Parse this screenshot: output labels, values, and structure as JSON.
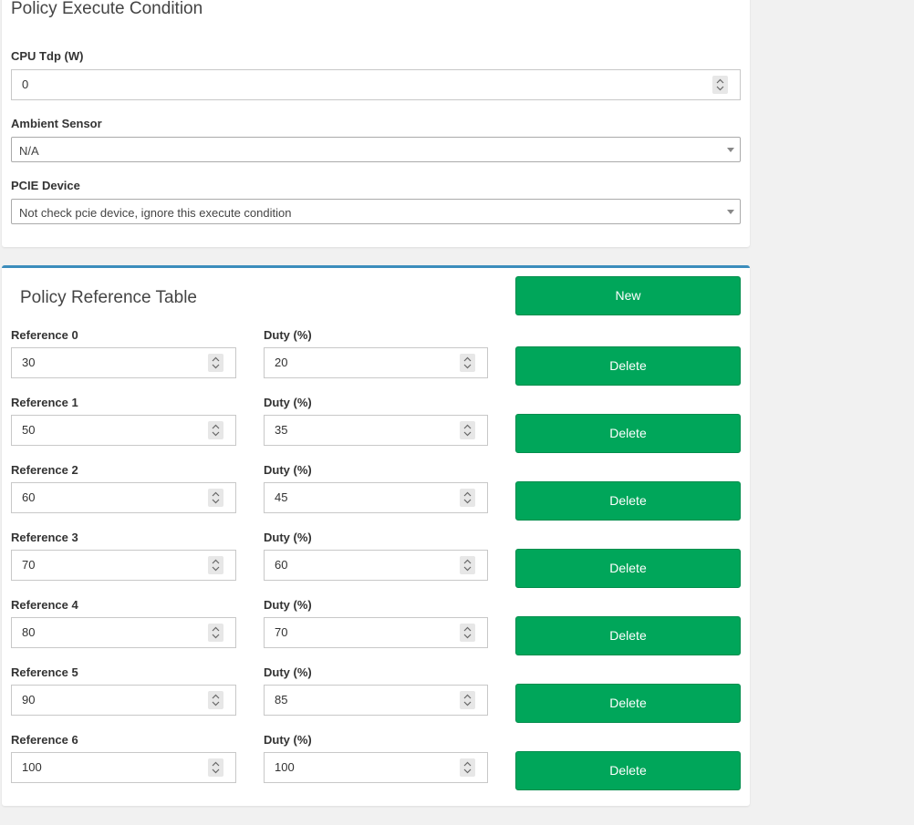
{
  "exec": {
    "title": "Policy Execute Condition",
    "cpu_tdp": {
      "label": "CPU Tdp (W)",
      "value": "0"
    },
    "ambient_sensor": {
      "label": "Ambient Sensor",
      "value": "N/A"
    },
    "pcie_device": {
      "label": "PCIE Device",
      "value": "Not check pcie device, ignore this execute condition"
    }
  },
  "ref": {
    "title": "Policy Reference Table",
    "new_label": "New",
    "rows": [
      {
        "ref_label": "Reference 0",
        "ref_value": "30",
        "duty_label": "Duty (%)",
        "duty_value": "20",
        "delete_label": "Delete"
      },
      {
        "ref_label": "Reference 1",
        "ref_value": "50",
        "duty_label": "Duty (%)",
        "duty_value": "35",
        "delete_label": "Delete"
      },
      {
        "ref_label": "Reference 2",
        "ref_value": "60",
        "duty_label": "Duty (%)",
        "duty_value": "45",
        "delete_label": "Delete"
      },
      {
        "ref_label": "Reference 3",
        "ref_value": "70",
        "duty_label": "Duty (%)",
        "duty_value": "60",
        "delete_label": "Delete"
      },
      {
        "ref_label": "Reference 4",
        "ref_value": "80",
        "duty_label": "Duty (%)",
        "duty_value": "70",
        "delete_label": "Delete"
      },
      {
        "ref_label": "Reference 5",
        "ref_value": "90",
        "duty_label": "Duty (%)",
        "duty_value": "85",
        "delete_label": "Delete"
      },
      {
        "ref_label": "Reference 6",
        "ref_value": "100",
        "duty_label": "Duty (%)",
        "duty_value": "100",
        "delete_label": "Delete"
      }
    ]
  },
  "colors": {
    "button_green": "#00a65a",
    "panel_accent": "#3c8dbc",
    "background": "#f1f1f1"
  }
}
